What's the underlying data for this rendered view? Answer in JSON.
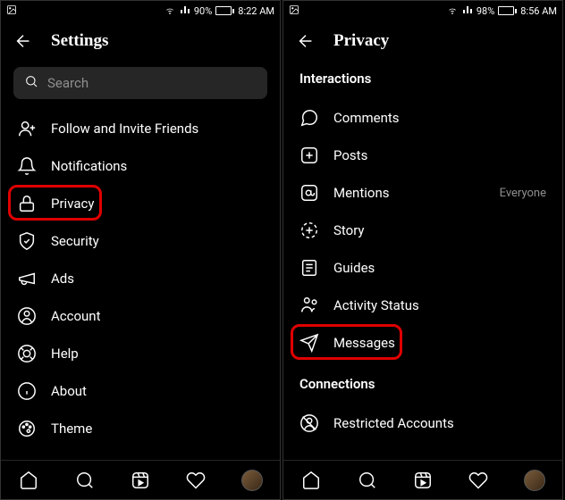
{
  "left": {
    "status": {
      "battery_pct": "90%",
      "time": "8:22 AM"
    },
    "header": {
      "title": "Settings"
    },
    "search": {
      "placeholder": "Search"
    },
    "items": [
      {
        "icon": "follow-icon",
        "label": "Follow and Invite Friends"
      },
      {
        "icon": "bell-icon",
        "label": "Notifications"
      },
      {
        "icon": "lock-icon",
        "label": "Privacy",
        "highlighted": true
      },
      {
        "icon": "shield-icon",
        "label": "Security"
      },
      {
        "icon": "megaphone-icon",
        "label": "Ads"
      },
      {
        "icon": "account-icon",
        "label": "Account"
      },
      {
        "icon": "help-icon",
        "label": "Help"
      },
      {
        "icon": "info-icon",
        "label": "About"
      },
      {
        "icon": "theme-icon",
        "label": "Theme"
      }
    ]
  },
  "right": {
    "status": {
      "battery_pct": "98%",
      "time": "8:56 AM"
    },
    "header": {
      "title": "Privacy"
    },
    "sections": {
      "interactions": "Interactions",
      "connections": "Connections"
    },
    "items1": [
      {
        "icon": "comment-icon",
        "label": "Comments"
      },
      {
        "icon": "plus-box-icon",
        "label": "Posts"
      },
      {
        "icon": "mentions-icon",
        "label": "Mentions",
        "value": "Everyone"
      },
      {
        "icon": "story-icon",
        "label": "Story"
      },
      {
        "icon": "guides-icon",
        "label": "Guides"
      },
      {
        "icon": "activity-icon",
        "label": "Activity Status"
      },
      {
        "icon": "messages-icon",
        "label": "Messages",
        "highlighted": true
      }
    ],
    "items2": [
      {
        "icon": "restricted-icon",
        "label": "Restricted Accounts"
      }
    ]
  }
}
